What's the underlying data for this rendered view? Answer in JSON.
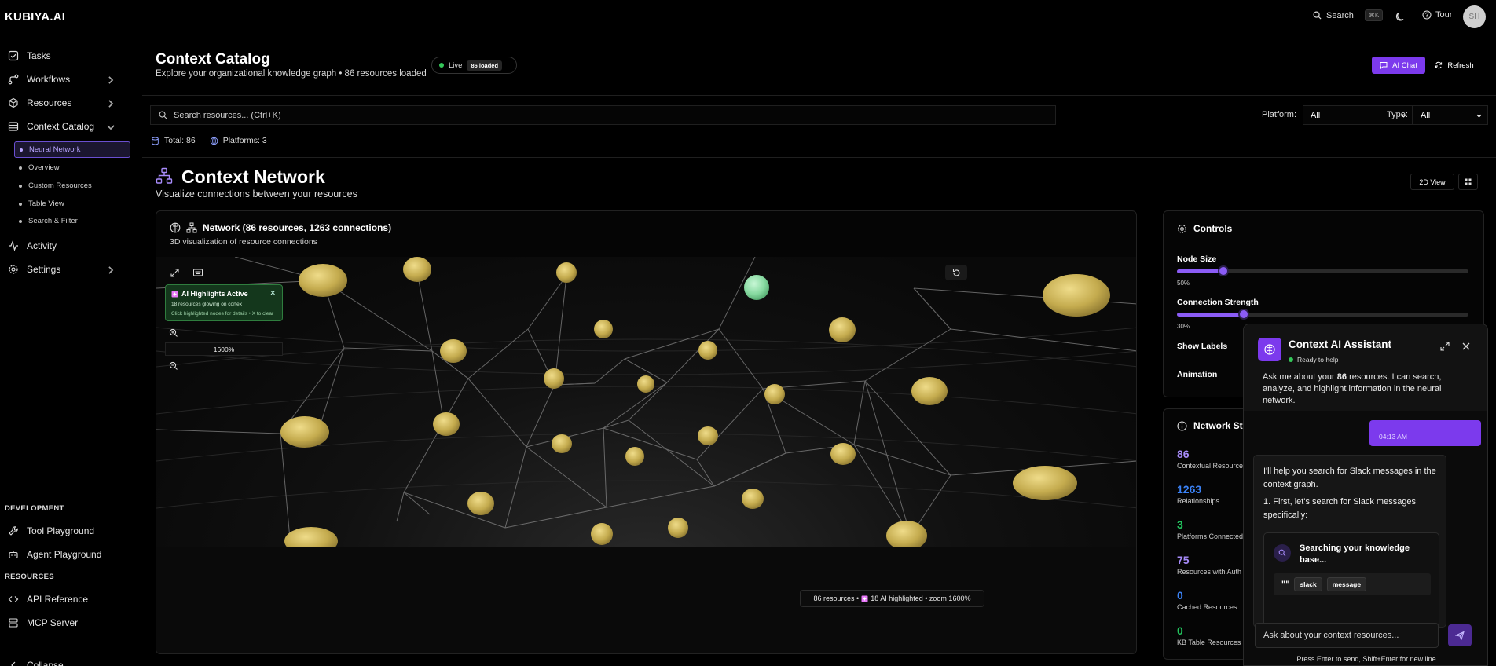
{
  "app": {
    "logo": "KUBIYA.AI"
  },
  "topbar": {
    "search_label": "Search",
    "search_shortcut": "⌘K",
    "tour_label": "Tour",
    "avatar_initials": "SH"
  },
  "sidebar": {
    "items": [
      {
        "label": "Tasks",
        "icon": "checkbox-icon"
      },
      {
        "label": "Workflows",
        "icon": "workflow-icon"
      },
      {
        "label": "Resources",
        "icon": "cube-icon"
      },
      {
        "label": "Context Catalog",
        "icon": "database-icon"
      }
    ],
    "sub_items": [
      {
        "label": "Neural Network",
        "active": true
      },
      {
        "label": "Overview"
      },
      {
        "label": "Custom Resources"
      },
      {
        "label": "Table View"
      },
      {
        "label": "Search & Filter"
      }
    ],
    "lower_items": [
      {
        "label": "Activity",
        "icon": "activity-icon"
      },
      {
        "label": "Settings",
        "icon": "gear-icon"
      }
    ],
    "development_label": "DEVELOPMENT",
    "development_items": [
      {
        "label": "Tool Playground",
        "icon": "wrench-icon"
      },
      {
        "label": "Agent Playground",
        "icon": "bot-icon"
      }
    ],
    "resources_label": "RESOURCES",
    "resource_items": [
      {
        "label": "API Reference",
        "icon": "code-icon"
      },
      {
        "label": "MCP Server",
        "icon": "server-icon"
      }
    ],
    "collapse_label": "Collapse"
  },
  "header": {
    "title": "Context Catalog",
    "subtitle": "Explore your organizational knowledge graph • 86 resources loaded",
    "live_label": "Live",
    "loaded_badge": "86 loaded",
    "ai_chat_label": "AI Chat",
    "refresh_label": "Refresh"
  },
  "search": {
    "placeholder": "Search resources... (Ctrl+K)",
    "platform_label": "Platform:",
    "platform_value": "All",
    "type_label": "Type:",
    "type_value": "All",
    "total_label": "Total: 86",
    "platforms_label": "Platforms: 3"
  },
  "network": {
    "title": "Context Network",
    "subtitle": "Visualize connections between your resources",
    "view_button": "2D View",
    "panel_title": "Network (86 resources, 1263 connections)",
    "panel_subtitle": "3D visualization of resource connections",
    "ai_highlight_title": "AI Highlights Active",
    "ai_highlight_line1": "18 resources glowing on cortex",
    "ai_highlight_line2": "Click highlighted nodes for details • X to clear",
    "zoom_value": "1600%",
    "footer_resources": "86 resources •",
    "footer_highlighted": "18 AI highlighted • zoom 1600%"
  },
  "controls": {
    "title": "Controls",
    "node_size_label": "Node Size",
    "node_size_value": "50%",
    "node_size_fraction": 0.16,
    "connection_strength_label": "Connection Strength",
    "connection_strength_value": "30%",
    "connection_strength_fraction": 0.23,
    "show_labels_label": "Show Labels",
    "animation_label": "Animation"
  },
  "network_stats": {
    "title": "Network Stats",
    "stats": [
      {
        "value": "86",
        "label": "Contextual Resources",
        "color": "#a78bfa"
      },
      {
        "value": "1263",
        "label": "Relationships",
        "color": "#3b82f6"
      },
      {
        "value": "3",
        "label": "Platforms Connected",
        "color": "#22c55e"
      },
      {
        "value": "75",
        "label": "Resources with Auth",
        "color": "#a78bfa"
      },
      {
        "value": "0",
        "label": "Cached Resources",
        "color": "#3b82f6"
      },
      {
        "value": "0",
        "label": "KB Table Resources",
        "color": "#22c55e"
      }
    ]
  },
  "assistant": {
    "title": "Context AI Assistant",
    "status": "Ready to help",
    "intro_prefix": "Ask me about your ",
    "intro_count": "86",
    "intro_suffix": " resources. I can search, analyze, and highlight information in the neural network.",
    "user_time": "04:13 AM",
    "bot_p1": "I'll help you search for Slack messages in the context graph.",
    "bot_p2": "1. First, let's search for Slack messages specifically:",
    "search_card_title": "Searching your knowledge base...",
    "keywords": [
      "slack",
      "message"
    ],
    "input_placeholder": "Ask about your context resources...",
    "hint": "Press Enter to send, Shift+Enter for new line"
  },
  "colors": {
    "accent": "#7c3aed",
    "live": "#34c759",
    "node": "#c9b35a",
    "node_highlight": "#8fe0a8"
  }
}
